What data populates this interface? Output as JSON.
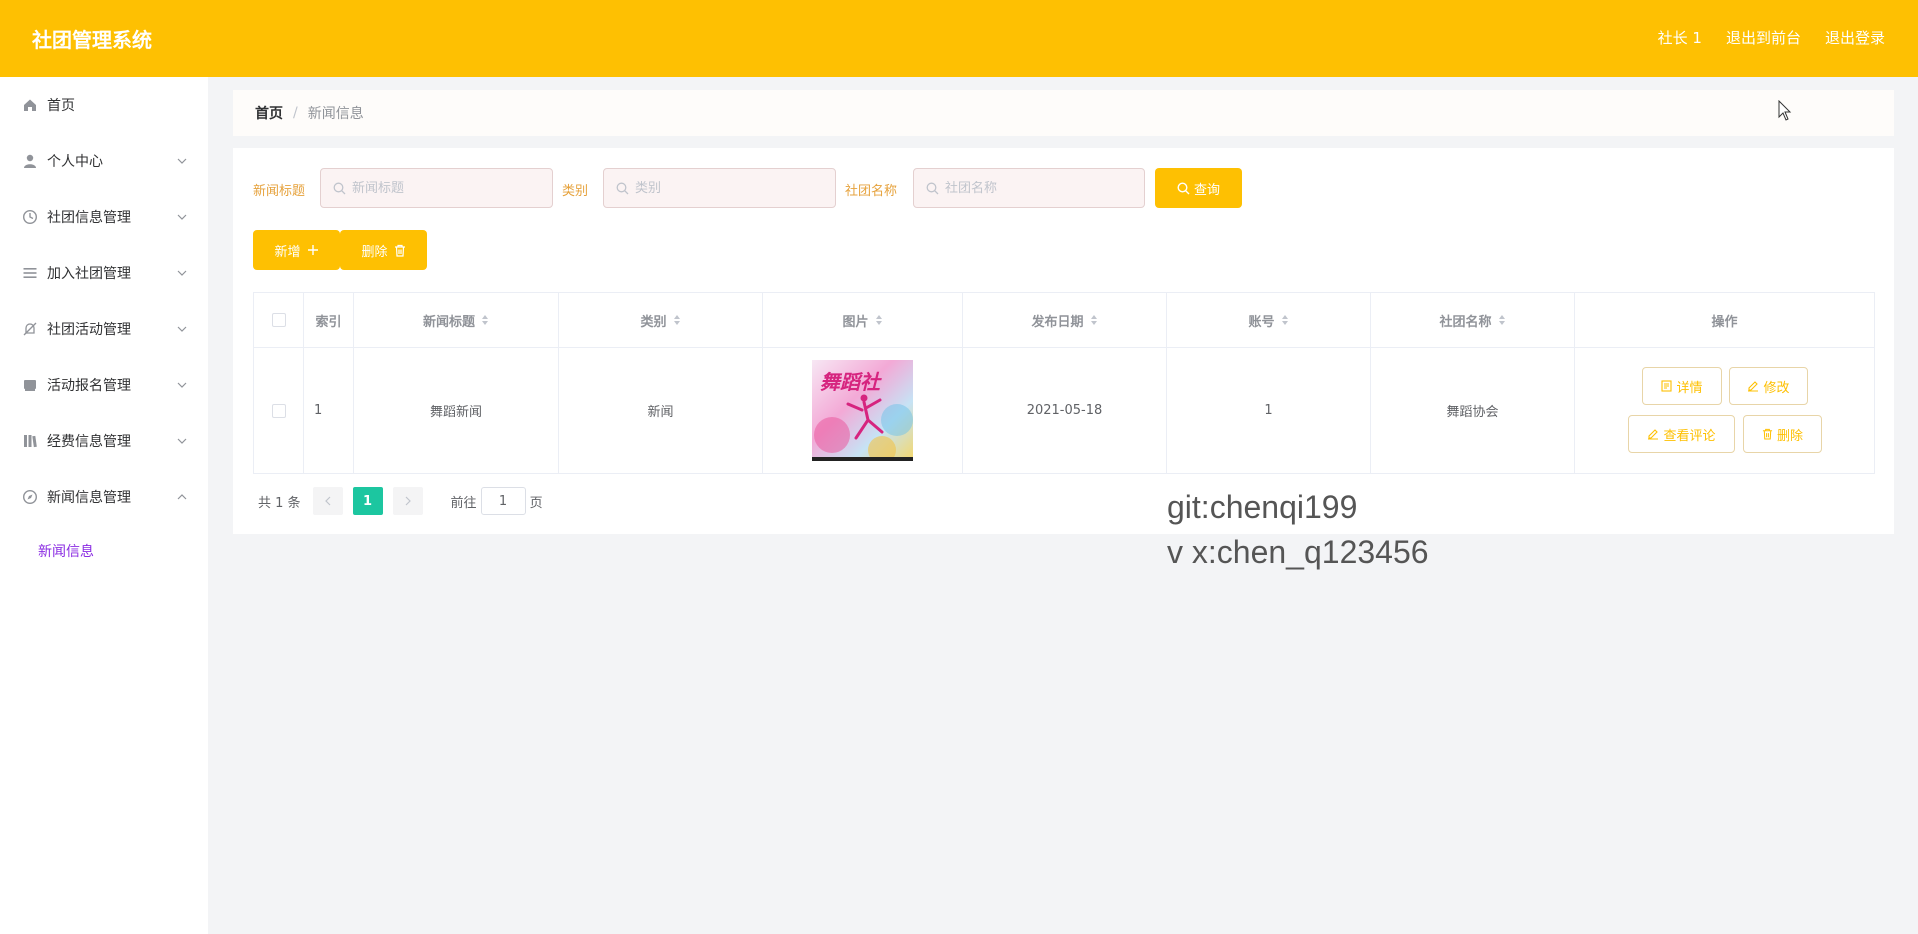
{
  "header": {
    "title": "社团管理系统",
    "links": [
      "社长 1",
      "退出到前台",
      "退出登录"
    ],
    "bg_color": "#fec002"
  },
  "sidebar": {
    "items": [
      {
        "label": "首页",
        "icon": "home-icon"
      },
      {
        "label": "个人中心",
        "icon": "user-icon"
      },
      {
        "label": "社团信息管理",
        "icon": "clock-icon"
      },
      {
        "label": "加入社团管理",
        "icon": "list-icon"
      },
      {
        "label": "社团活动管理",
        "icon": "bell-off-icon"
      },
      {
        "label": "活动报名管理",
        "icon": "receipt-icon"
      },
      {
        "label": "经费信息管理",
        "icon": "library-icon"
      },
      {
        "label": "新闻信息管理",
        "icon": "compass-icon"
      }
    ],
    "sub_item": "新闻信息"
  },
  "breadcrumb": {
    "home": "首页",
    "separator": "/",
    "current": "新闻信息"
  },
  "search": {
    "title_label": "新闻标题",
    "title_placeholder": "新闻标题",
    "category_label": "类别",
    "category_placeholder": "类别",
    "club_label": "社团名称",
    "club_placeholder": "社团名称",
    "query_button": "查询"
  },
  "actions": {
    "add": "新增",
    "delete": "删除"
  },
  "table": {
    "headers": [
      "索引",
      "新闻标题",
      "类别",
      "图片",
      "发布日期",
      "账号",
      "社团名称",
      "操作"
    ],
    "rows": [
      {
        "index": "1",
        "title": "舞蹈新闻",
        "category": "新闻",
        "image_text": "舞蹈社",
        "date": "2021-05-18",
        "account": "1",
        "club": "舞蹈协会"
      }
    ],
    "row_actions": [
      "详情",
      "修改",
      "查看评论",
      "删除"
    ]
  },
  "pagination": {
    "total": "共 1 条",
    "current_page": "1",
    "goto_label": "前往",
    "goto_value": "1",
    "page_suffix": "页"
  },
  "watermark": {
    "line1": "git:chenqi199",
    "line2": "v x:chen_q123456"
  },
  "colors": {
    "accent": "#fec002",
    "page_active": "#1cc6a0",
    "submenu_active": "#8a2be2"
  }
}
